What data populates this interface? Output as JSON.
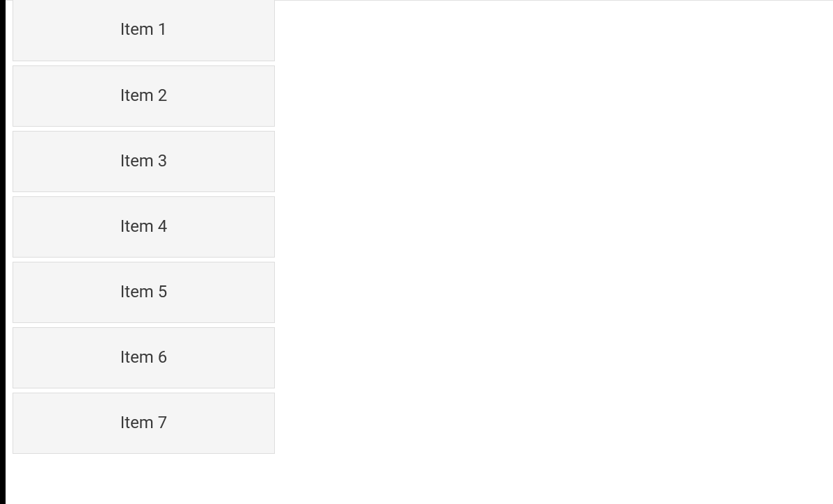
{
  "list": {
    "items": [
      {
        "label": "Item 1"
      },
      {
        "label": "Item 2"
      },
      {
        "label": "Item 3"
      },
      {
        "label": "Item 4"
      },
      {
        "label": "Item 5"
      },
      {
        "label": "Item 6"
      },
      {
        "label": "Item 7"
      }
    ]
  }
}
